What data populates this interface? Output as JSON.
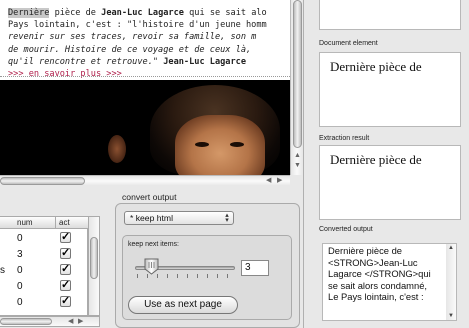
{
  "browser": {
    "line1_highlight": "Dernière",
    "line1_mid": " pièce de ",
    "line1_bold": "Jean-Luc Lagarce",
    "line1_end": " qui se sait alo",
    "line2": "Pays lointain, c'est : \"l'histoire d'un jeune homm",
    "line3": "revenir sur ses traces, revoir sa famille, son m",
    "line4": "de mourir. Histoire de ce voyage et de ceux là,",
    "line5_italic": "qu'il rencontre et retrouve.\"",
    "line5_bold": " Jean-Luc Lagarce",
    "link": ">>> en savoir plus >>>"
  },
  "right_panel": {
    "document_element_label": "Document element",
    "document_element_value": "Dernière pièce de",
    "extraction_result_label": "Extraction result",
    "extraction_result_value": "Dernière pièce de",
    "converted_output_label": "Converted output",
    "converted_lines": [
      "Dernière pièce de",
      "<STRONG>Jean-Luc",
      "Lagarce </STRONG>qui",
      "se sait alors condamné,",
      "Le Pays lointain, c'est :"
    ]
  },
  "table": {
    "headers": [
      "num",
      "act"
    ],
    "rows": [
      {
        "name": "",
        "num": "0",
        "checked": true
      },
      {
        "name": "",
        "num": "3",
        "checked": true
      },
      {
        "name": "s",
        "num": "0",
        "checked": true
      },
      {
        "name": "",
        "num": "0",
        "checked": true
      },
      {
        "name": "",
        "num": "0",
        "checked": true
      }
    ]
  },
  "convert": {
    "title": "convert output",
    "select_value": "* keep  html",
    "keep_label": "keep next items:",
    "slider_value": 3,
    "keep_value": "3",
    "button_label": "Use as next page"
  },
  "icons": {
    "checkbox": "checkmark-icon",
    "select_caret": "updown-caret-icon",
    "scroll_arrows": "scroll-arrow-icon"
  },
  "colors": {
    "link": "#b0204c",
    "highlight": "#c8c8c8",
    "panel_bg": "#e8e8e8"
  }
}
